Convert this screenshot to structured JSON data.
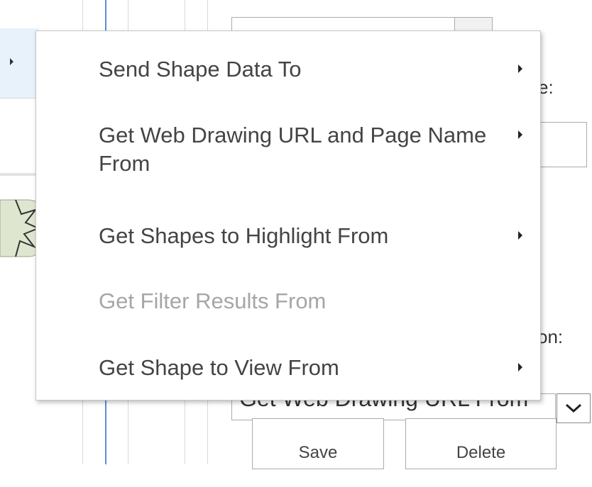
{
  "background": {
    "label_name_suffix": "e:",
    "label_action_suffix": "on:",
    "select_value": "Get Web Drawing URL From",
    "save_label": "Save",
    "delete_label": "Delete"
  },
  "context_menu": {
    "items": [
      {
        "label": "Send Shape Data To",
        "has_submenu": true,
        "enabled": true
      },
      {
        "label": "Get Web Drawing URL and Page Name From",
        "has_submenu": true,
        "enabled": true
      },
      {
        "label": "Get Shapes to Highlight From",
        "has_submenu": true,
        "enabled": true
      },
      {
        "label": "Get Filter Results From",
        "has_submenu": false,
        "enabled": false
      },
      {
        "label": "Get Shape to View From",
        "has_submenu": true,
        "enabled": true
      }
    ]
  },
  "colors": {
    "menu_text": "#444444",
    "disabled_text": "#a6a6a6",
    "accent_line": "#5b8fd0"
  }
}
